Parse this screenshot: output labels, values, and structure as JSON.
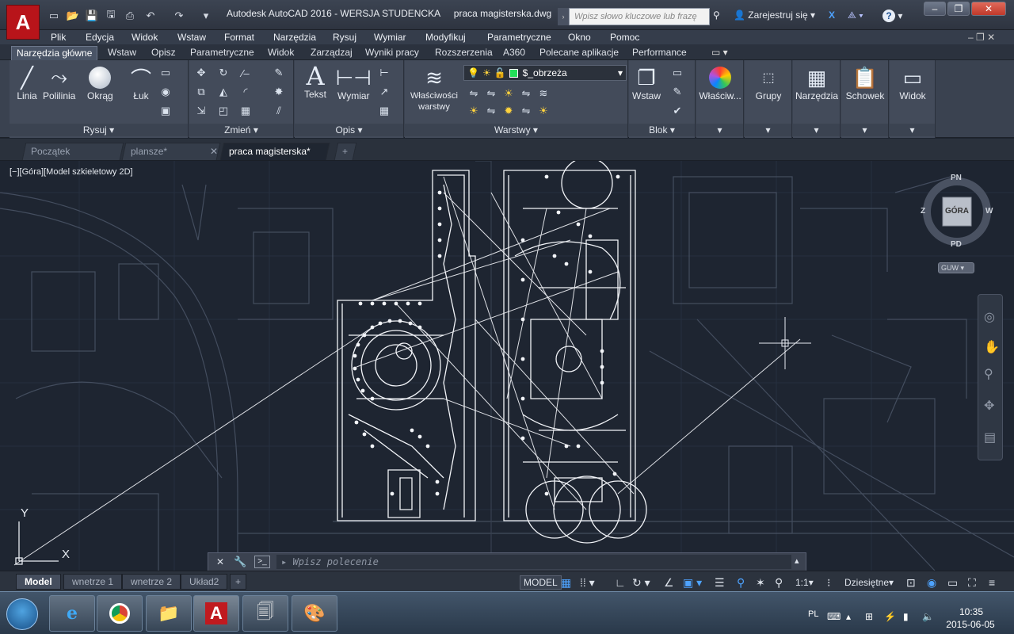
{
  "titlebar": {
    "app_title": "Autodesk AutoCAD 2016 - WERSJA STUDENCKA",
    "file_name": "praca magisterska.dwg",
    "search_placeholder": "Wpisz słowo kluczowe lub frazę",
    "signin_label": "Zarejestruj się",
    "help_label": "?"
  },
  "menu": [
    "Plik",
    "Edycja",
    "Widok",
    "Wstaw",
    "Format",
    "Narzędzia",
    "Rysuj",
    "Wymiar",
    "Modyfikuj",
    "Parametryczne",
    "Okno",
    "Pomoc"
  ],
  "ribbon_tabs": [
    "Narzędzia główne",
    "Wstaw",
    "Opisz",
    "Parametryczne",
    "Widok",
    "Zarządzaj",
    "Wyniki pracy",
    "Rozszerzenia",
    "A360",
    "Polecane aplikacje",
    "Performance"
  ],
  "ribbon": {
    "rysuj": {
      "title": "Rysuj",
      "linia": "Linia",
      "polilinia": "Polilinia",
      "okrag": "Okrąg",
      "luk": "Łuk"
    },
    "zmien": {
      "title": "Zmień"
    },
    "opis": {
      "title": "Opis",
      "tekst": "Tekst",
      "wymiar": "Wymiar"
    },
    "warstwy": {
      "title": "Warstwy",
      "props_label": "Właściwości warstwy",
      "layer_name": "$_obrzeża"
    },
    "blok": {
      "title": "Blok",
      "wstaw": "Wstaw"
    },
    "wlasciwosci": "Właściw...",
    "grupy": "Grupy",
    "narzedzia": "Narzędzia",
    "schowek": "Schowek",
    "widok": "Widok"
  },
  "file_tabs": [
    {
      "label": "Początek"
    },
    {
      "label": "plansze*"
    },
    {
      "label": "praca magisterska*"
    }
  ],
  "viewport_label": "[−][Góra][Model szkieletowy 2D]",
  "viewcube": {
    "top": "PN",
    "bottom": "PD",
    "left": "Z",
    "right": "W",
    "face": "GÓRA",
    "ucs": "GUW"
  },
  "ucs": {
    "x": "X",
    "y": "Y"
  },
  "command": {
    "placeholder": "Wpisz polecenie"
  },
  "layout_tabs": [
    "Model",
    "wnetrze 1",
    "wnetrze 2",
    "Układ2"
  ],
  "status": {
    "model": "MODEL",
    "scale": "1:1",
    "units": "Dziesiętne"
  },
  "taskbar": {
    "lang": "PL",
    "time": "10:35",
    "date": "2015-06-05"
  }
}
